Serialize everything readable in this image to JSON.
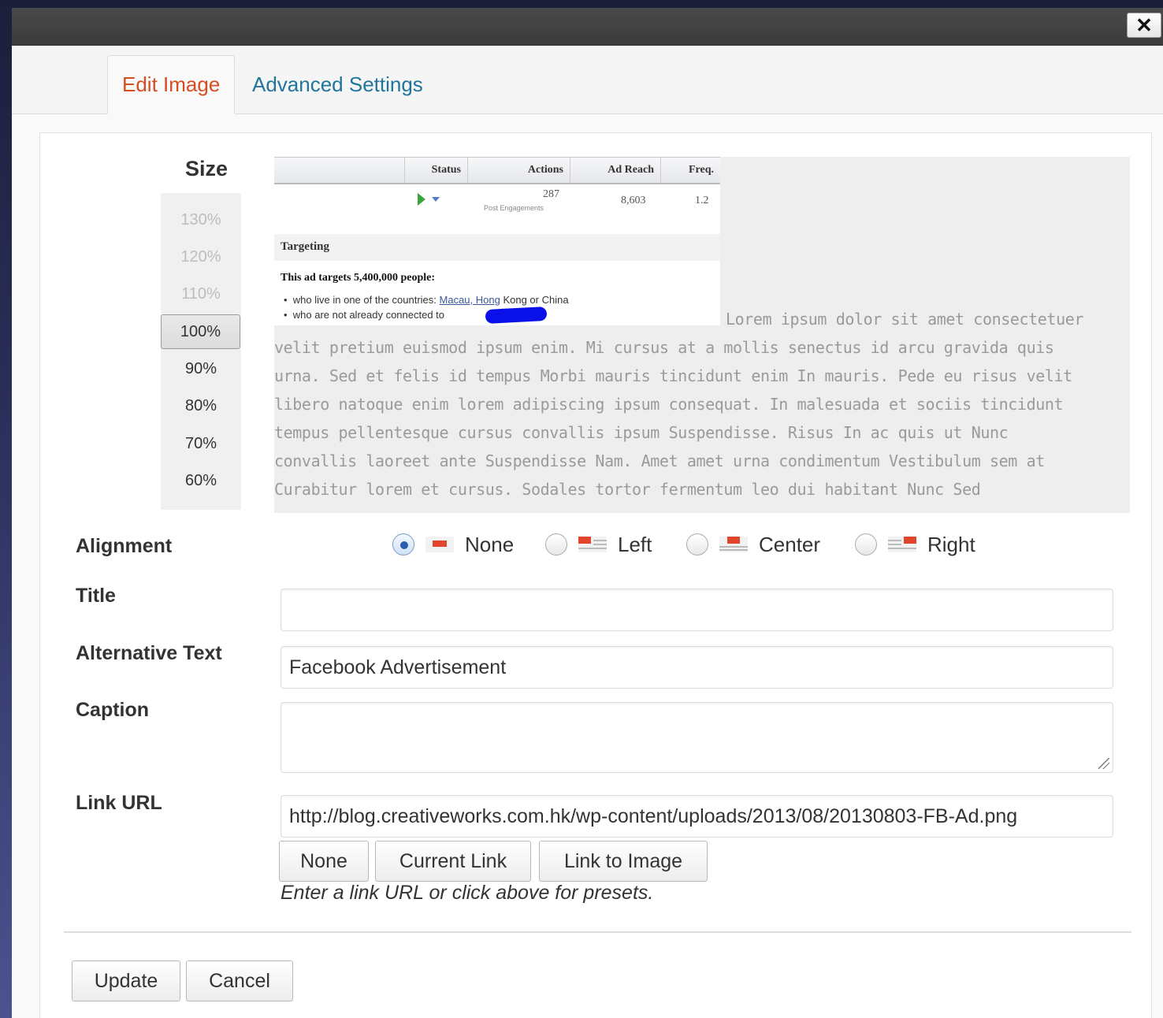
{
  "dialog": {
    "close_label": "✕"
  },
  "tabs": [
    {
      "label": "Edit Image",
      "active": true
    },
    {
      "label": "Advanced Settings",
      "active": false
    }
  ],
  "size": {
    "label": "Size",
    "options": [
      "130%",
      "120%",
      "110%",
      "100%",
      "90%",
      "80%",
      "70%",
      "60%"
    ],
    "selected": "100%"
  },
  "preview": {
    "fb_table": {
      "headers": [
        "Status",
        "Actions",
        "Ad Reach",
        "Freq."
      ],
      "actions_value": "287",
      "actions_sub": "Post Engagements",
      "reach_value": "8,603",
      "freq_value": "1.2",
      "targeting_title": "Targeting",
      "targets_text": "This ad targets 5,400,000 people:",
      "bullet1_prefix": "who live in one of the countries: ",
      "bullet1_link": "Macau, Hong",
      "bullet1_suffix": " Kong or China",
      "bullet2": "who are not already connected to"
    },
    "lorem_lines": [
      "Lorem ipsum dolor sit amet consectetuer",
      "velit pretium euismod ipsum enim. Mi cursus at a mollis senectus id arcu gravida quis",
      "urna. Sed et felis id tempus Morbi mauris tincidunt enim In mauris. Pede eu risus velit",
      "libero natoque enim lorem adipiscing ipsum consequat. In malesuada et sociis tincidunt",
      "tempus pellentesque cursus convallis ipsum Suspendisse. Risus In ac quis ut Nunc",
      "convallis laoreet ante Suspendisse Nam. Amet amet urna condimentum Vestibulum sem at",
      "Curabitur lorem et cursus. Sodales tortor fermentum leo dui habitant Nunc Sed"
    ]
  },
  "alignment": {
    "label": "Alignment",
    "options": [
      "None",
      "Left",
      "Center",
      "Right"
    ],
    "selected": "None"
  },
  "fields": {
    "title_label": "Title",
    "title_value": "",
    "alt_label": "Alternative Text",
    "alt_value": "Facebook Advertisement",
    "caption_label": "Caption",
    "caption_value": "",
    "link_label": "Link URL",
    "link_value": "http://blog.creativeworks.com.hk/wp-content/uploads/2013/08/20130803-FB-Ad.png"
  },
  "link_buttons": [
    "None",
    "Current Link",
    "Link to Image"
  ],
  "link_hint": "Enter a link URL or click above for presets.",
  "footer": {
    "update_label": "Update",
    "cancel_label": "Cancel"
  },
  "colors": {
    "active_tab": "#d54e21",
    "inactive_tab": "#21759b",
    "accent_red": "#e2452b"
  }
}
